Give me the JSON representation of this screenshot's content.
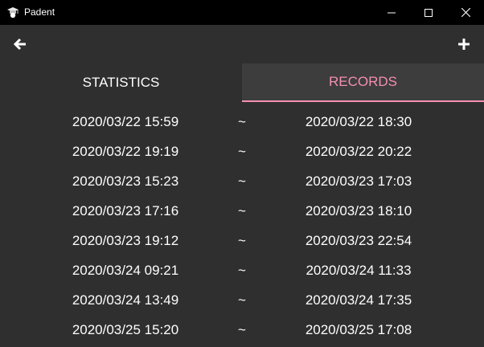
{
  "window": {
    "title": "Padent",
    "icon": "graduation-cap-icon"
  },
  "toolbar": {
    "back_icon": "arrow-left-icon",
    "add_icon": "plus-icon"
  },
  "tabs": [
    {
      "label": "STATISTICS",
      "active": false
    },
    {
      "label": "RECORDS",
      "active": true
    }
  ],
  "colors": {
    "accent": "#f48fb1",
    "background": "#2f2f2f",
    "active_tab_bg": "#3d3d3d",
    "titlebar": "#000000",
    "text": "#ffffff"
  },
  "records": [
    {
      "start": "2020/03/22 15:59",
      "sep": "~",
      "end": "2020/03/22 18:30"
    },
    {
      "start": "2020/03/22 19:19",
      "sep": "~",
      "end": "2020/03/22 20:22"
    },
    {
      "start": "2020/03/23 15:23",
      "sep": "~",
      "end": "2020/03/23 17:03"
    },
    {
      "start": "2020/03/23 17:16",
      "sep": "~",
      "end": "2020/03/23 18:10"
    },
    {
      "start": "2020/03/23 19:12",
      "sep": "~",
      "end": "2020/03/23 22:54"
    },
    {
      "start": "2020/03/24 09:21",
      "sep": "~",
      "end": "2020/03/24 11:33"
    },
    {
      "start": "2020/03/24 13:49",
      "sep": "~",
      "end": "2020/03/24 17:35"
    },
    {
      "start": "2020/03/25 15:20",
      "sep": "~",
      "end": "2020/03/25 17:08"
    }
  ]
}
